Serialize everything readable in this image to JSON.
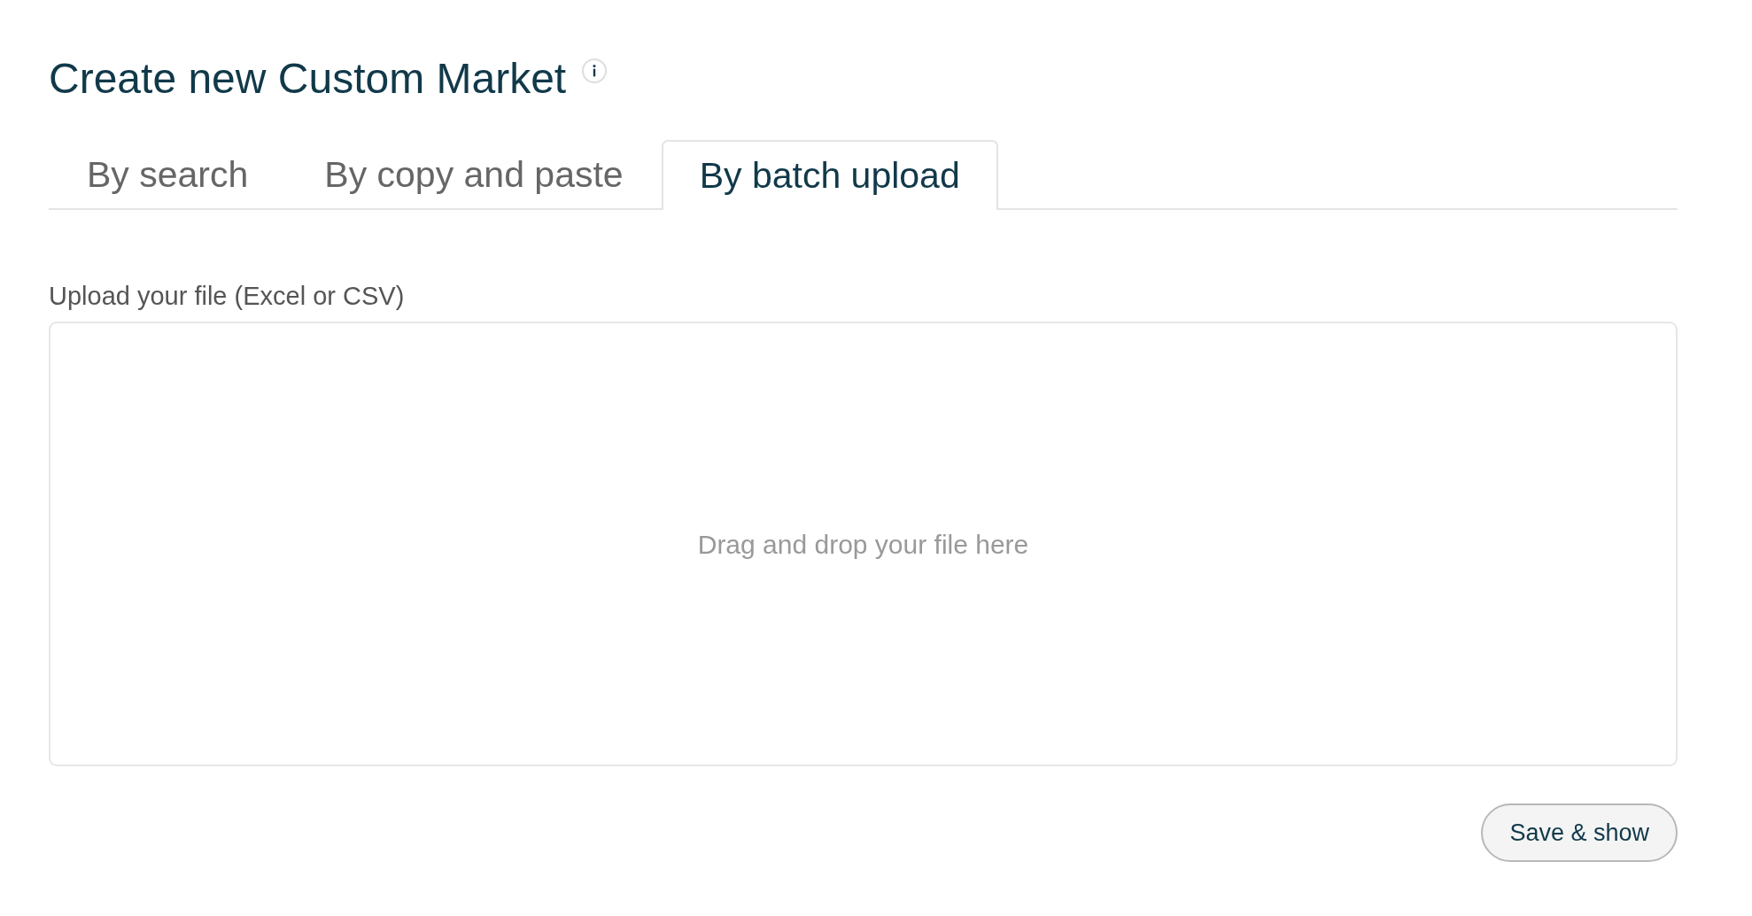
{
  "page": {
    "title": "Create new Custom Market"
  },
  "tabs": [
    {
      "label": "By search",
      "selected": false
    },
    {
      "label": "By copy and paste",
      "selected": false
    },
    {
      "label": "By batch upload",
      "selected": true
    }
  ],
  "upload": {
    "label": "Upload your file (Excel or CSV)",
    "drop_hint": "Drag and drop your file here"
  },
  "buttons": [
    {
      "label": "Save & show"
    }
  ]
}
